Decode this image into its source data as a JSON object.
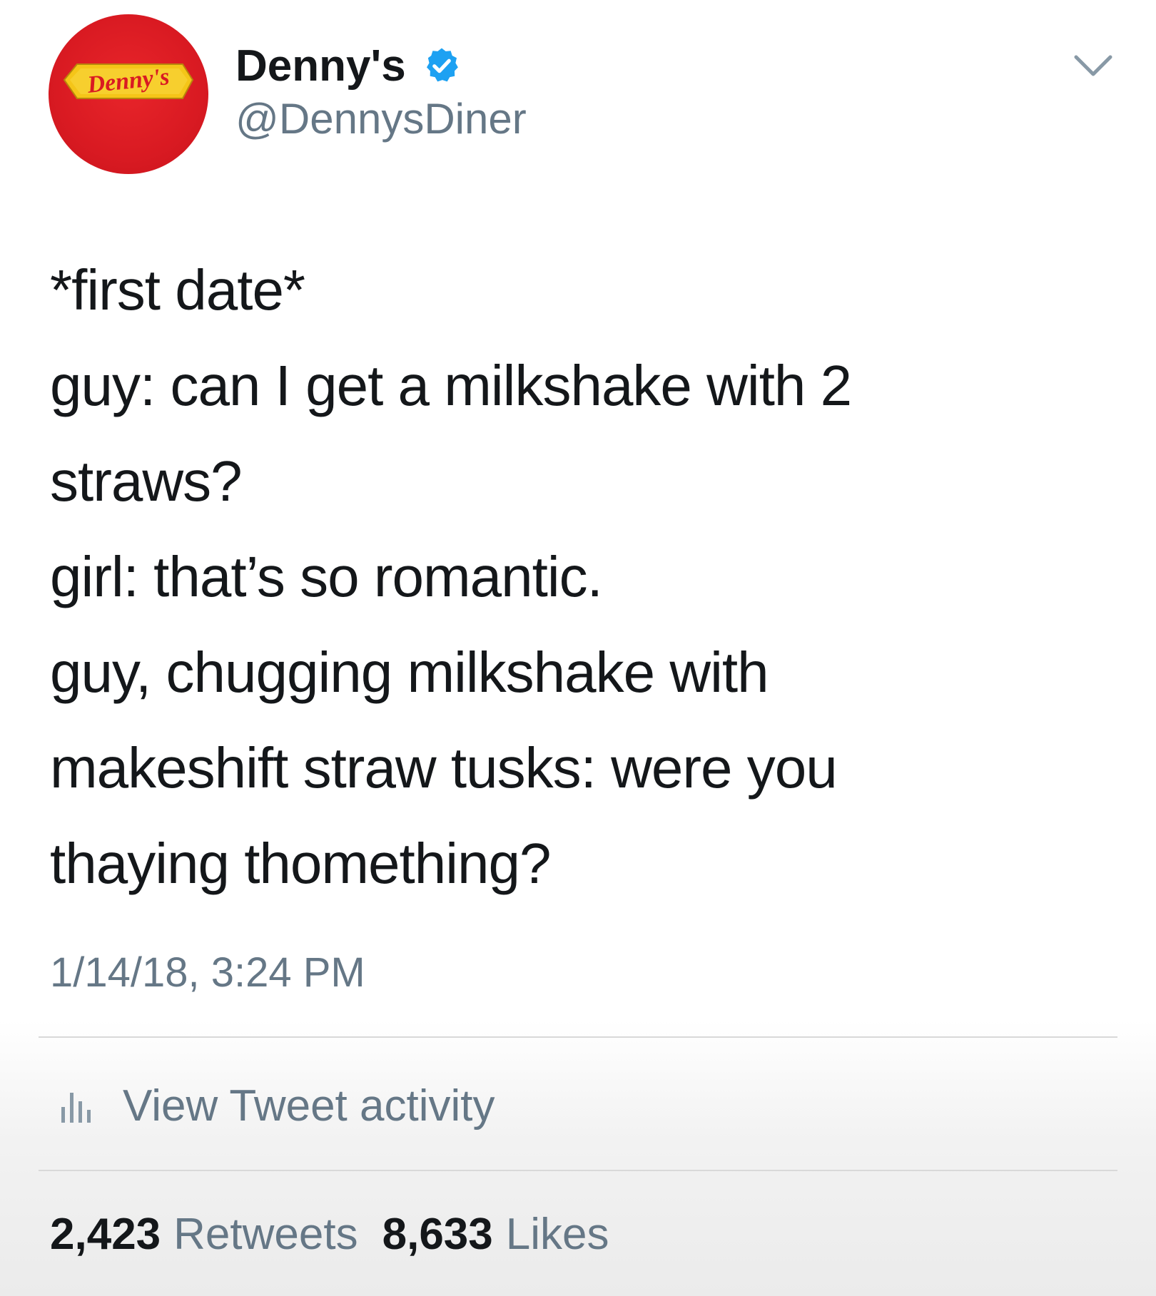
{
  "tweet": {
    "author": {
      "display_name": "Denny's",
      "handle": "@DennysDiner",
      "verified": true,
      "avatar_logo_text": "Denny's",
      "avatar_colors": {
        "circle": "#d91a22",
        "badge": "#f5c518",
        "logo_text": "#d91a22"
      }
    },
    "body_lines": [
      "*first date*",
      "guy: can I get a milkshake with 2",
      "straws?",
      "girl: that’s so romantic.",
      "guy, chugging milkshake with",
      "makeshift straw tusks: were you",
      "thaying thomething?"
    ],
    "timestamp": "1/14/18, 3:24 PM",
    "activity": {
      "label": "View Tweet activity",
      "icon": "bar-chart-icon"
    },
    "stats": {
      "retweets_count": "2,423",
      "retweets_label": "Retweets",
      "likes_count": "8,633",
      "likes_label": "Likes"
    },
    "menu_icon": "chevron-down-icon",
    "verified_color": "#1da1f2"
  }
}
